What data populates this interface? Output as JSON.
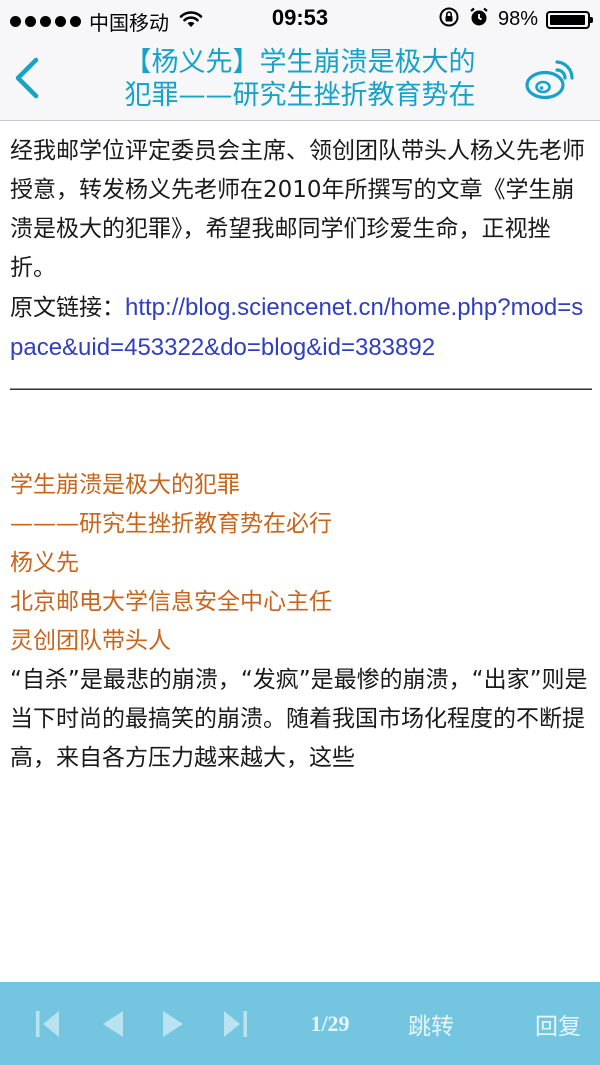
{
  "status_bar": {
    "carrier": "中国移动",
    "time": "09:53",
    "battery_percent": "98%",
    "battery_level": 0.98,
    "icons": [
      "signal-dots-icon",
      "wifi-icon",
      "orientation-lock-icon",
      "alarm-icon",
      "battery-icon"
    ]
  },
  "nav": {
    "back_icon": "chevron-left-icon",
    "title_line1": "【杨义先】学生崩溃是极大的",
    "title_line2": "犯罪——研究生挫折教育势在",
    "share_icon": "weibo-icon",
    "accent_color": "#17a3c9"
  },
  "article": {
    "intro": "经我邮学位评定委员会主席、领创团队带头人杨义先老师授意，转发杨义先老师在2010年所撰写的文章《学生崩溃是极大的犯罪》，希望我邮同学们珍爱生命，正视挫折。",
    "link_label": "原文链接：",
    "link_url": "http://blog.sciencenet.cn/home.php?mod=space&uid=453322&do=blog&id=383892",
    "divider": "———————————————————————————————————————————",
    "header_lines": [
      "学生崩溃是极大的犯罪",
      "———研究生挫折教育势在必行",
      "杨义先",
      "北京邮电大学信息安全中心主任",
      "灵创团队带头人"
    ],
    "header_color": "#c8641b",
    "body": "“自杀”是最悲的崩溃，“发疯”是最惨的崩溃，“出家”则是当下时尚的最搞笑的崩溃。随着我国市场化程度的不断提高，来自各方压力越来越大，这些"
  },
  "toolbar": {
    "first_icon": "skip-first-icon",
    "prev_icon": "play-left-icon",
    "next_icon": "play-right-icon",
    "last_icon": "skip-last-icon",
    "page_indicator": "1/29",
    "jump_label": "跳转",
    "reply_label": "回复",
    "background": "#74c6e0"
  }
}
